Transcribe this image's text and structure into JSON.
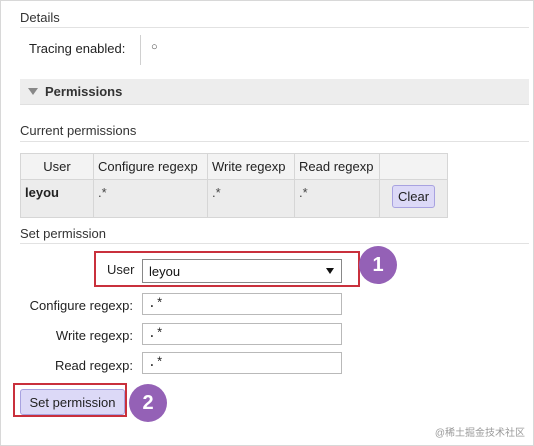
{
  "details": {
    "title": "Details",
    "tracing_label": "Tracing enabled:",
    "tracing_value": "○"
  },
  "permissions_section": {
    "title": "Permissions",
    "toggle_icon": "triangle-down-icon"
  },
  "current_permissions": {
    "title": "Current permissions",
    "columns": [
      "User",
      "Configure regexp",
      "Write regexp",
      "Read regexp"
    ],
    "rows": [
      {
        "user": "leyou",
        "configure": ".*",
        "write": ".*",
        "read": ".*",
        "action_label": "Clear"
      }
    ]
  },
  "set_permission": {
    "title": "Set permission",
    "user_label": "User",
    "user_value": "leyou",
    "configure_label": "Configure regexp:",
    "configure_value": ".*",
    "write_label": "Write regexp:",
    "write_value": ".*",
    "read_label": "Read regexp:",
    "read_value": ".*",
    "submit_label": "Set permission"
  },
  "annotations": {
    "step1": "1",
    "step2": "2",
    "highlight_color": "#c9303c",
    "badge_color": "#9461b6"
  },
  "watermark": "@稀土掘金技术社区"
}
